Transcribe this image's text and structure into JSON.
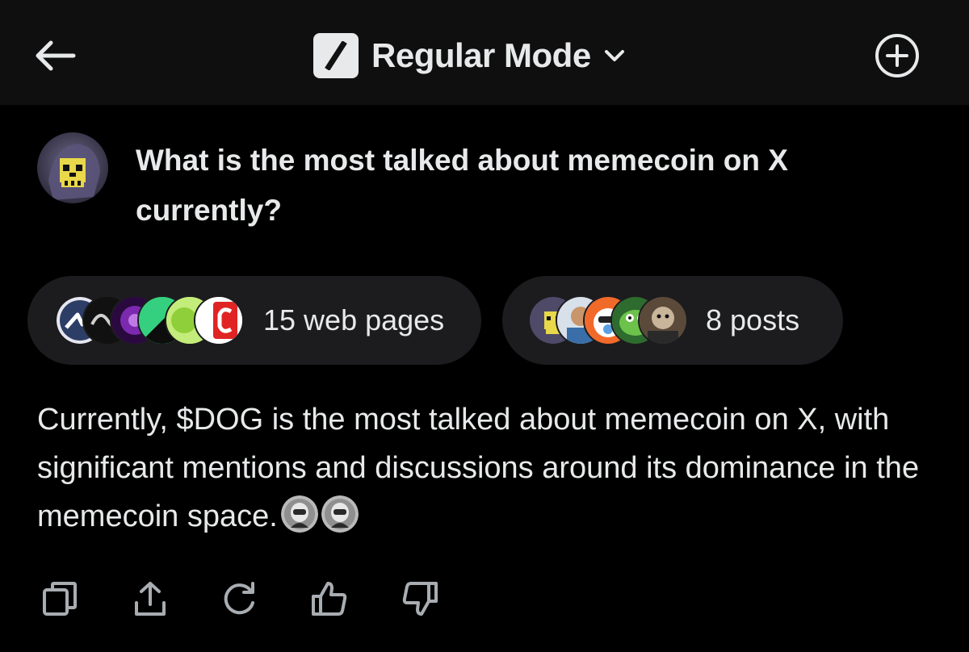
{
  "header": {
    "title": "Regular Mode",
    "icons": {
      "back": "arrow-left-icon",
      "mode": "slash-logo-icon",
      "dropdown": "chevron-down-icon",
      "new": "plus-circle-icon"
    }
  },
  "conversation": {
    "question": "What is the most talked about memecoin on X currently?",
    "sources": {
      "web_pages_label": "15 web pages",
      "posts_label": "8 posts"
    },
    "answer": "Currently, $DOG is the most talked about memecoin on X, with significant mentions and discussions around its dominance in the memecoin space."
  },
  "actions": [
    "copy-icon",
    "share-icon",
    "regenerate-icon",
    "thumbs-up-icon",
    "thumbs-down-icon"
  ],
  "colors": {
    "background": "#000000",
    "header": "#0f0f0f",
    "chip": "#1c1c1e",
    "text": "#e7e9ea"
  }
}
